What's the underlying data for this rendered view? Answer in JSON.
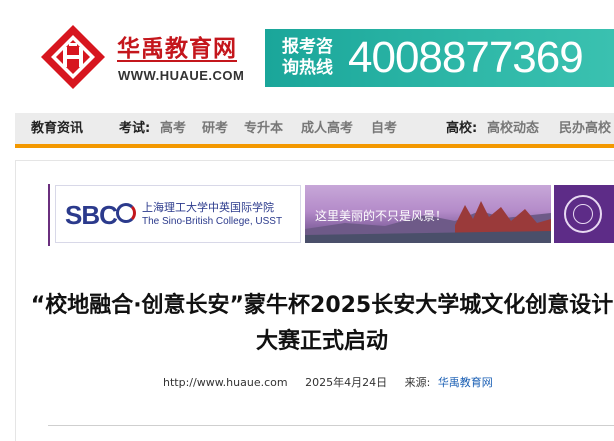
{
  "header": {
    "logo_cn": "华禹教育网",
    "logo_en": "WWW.HUAUE.COM",
    "hotline_label": "报考咨询热线",
    "hotline_number": "4008877369",
    "brand_color": "#c4161c",
    "hotline_color": "#1aa69a"
  },
  "nav": {
    "news": "教育资讯",
    "exam_label": "考试:",
    "exam_links": [
      "高考",
      "研考",
      "专升本",
      "成人高考",
      "自考"
    ],
    "school_label": "高校:",
    "school_links": [
      "高校动态",
      "民办高校"
    ],
    "accent_color": "#f39800"
  },
  "ads": {
    "sbc_logo": "SBC",
    "sbc_cn": "上海理工大学中英国际学院",
    "sbc_en": "The Sino-British College, USST",
    "scenery_text": "这里美丽的不只是风景！"
  },
  "article": {
    "title": "“校地融合·创意长安”蒙牛杯2025长安大学城文化创意设计大赛正式启动",
    "url": "http://www.huaue.com",
    "date": "2025年4月24日",
    "source_label": "来源:",
    "source": "华禹教育网"
  }
}
